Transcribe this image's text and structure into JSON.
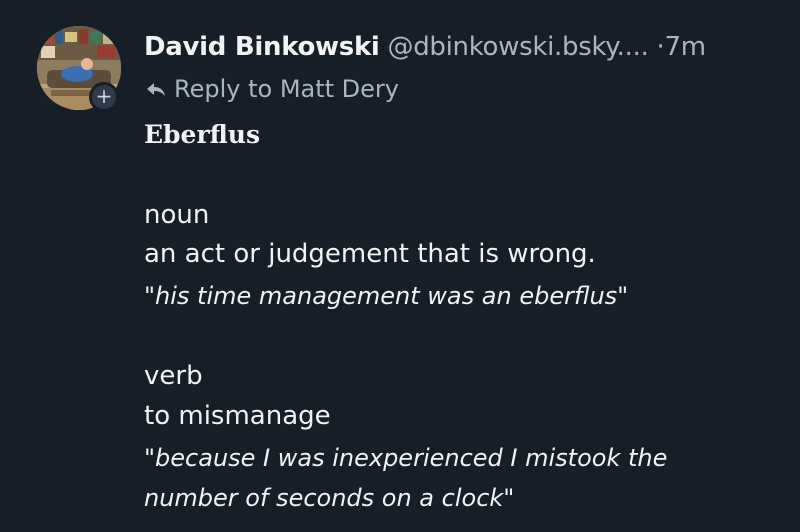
{
  "post": {
    "author": {
      "display_name": "David Binkowski",
      "handle": "@dbinkowski.bsky....",
      "timestamp": "7m"
    },
    "follow_badge": "+",
    "reply_to": "Reply to Matt Dery",
    "body": {
      "title": "Eberflus",
      "noun": {
        "part_of_speech": "noun",
        "definition": "an act or judgement that is wrong.",
        "example": "\"his time management was an eberflus\""
      },
      "verb": {
        "part_of_speech": "verb",
        "definition": "to mismanage",
        "example_line1": "\"because I was inexperienced I mistook the",
        "example_line2": "number of seconds on a clock\""
      }
    }
  },
  "icons": {
    "reply": "reply-arrow-icon",
    "follow": "plus-icon"
  },
  "colors": {
    "background": "#161e27",
    "primary_text": "#f1f3f5",
    "secondary_text": "#aab5c1"
  }
}
